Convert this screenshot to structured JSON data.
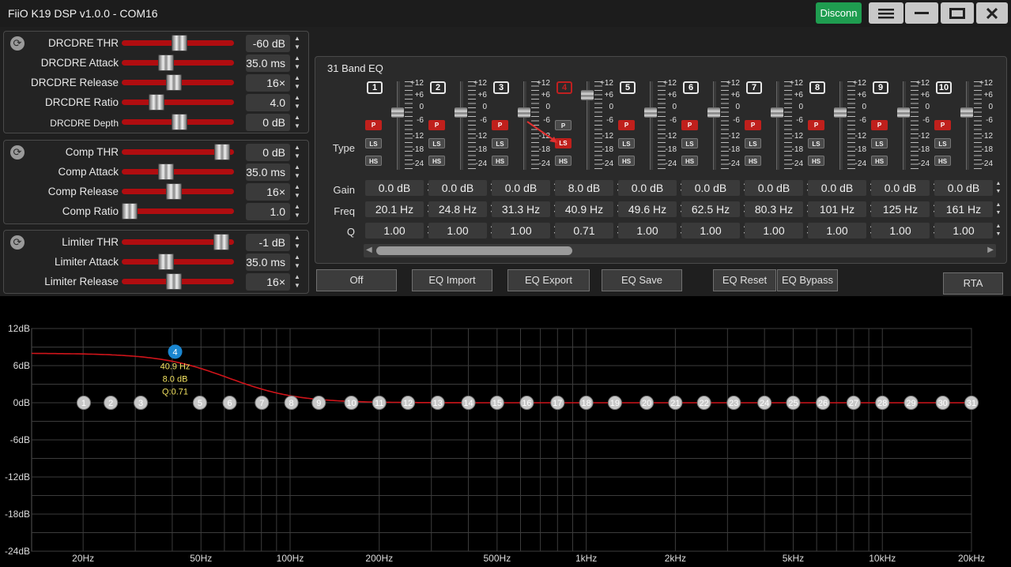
{
  "window": {
    "title": "FiiO K19 DSP v1.0.0 - COM16",
    "disconnect_label": "Disconn"
  },
  "drc": [
    {
      "label": "DRCDRE THR",
      "value": "-60 dB",
      "level": 0.52
    },
    {
      "label": "DRCDRE Attack",
      "value": "35.0 ms",
      "level": 0.38
    },
    {
      "label": "DRCDRE Release",
      "value": "16×",
      "level": 0.46
    },
    {
      "label": "DRCDRE Ratio",
      "value": "4.0",
      "level": 0.28
    },
    {
      "label": "DRCDRE Depth",
      "value": "0 dB",
      "level": 0.52
    }
  ],
  "comp": [
    {
      "label": "Comp THR",
      "value": "0 dB",
      "level": 0.96
    },
    {
      "label": "Comp Attack",
      "value": "35.0 ms",
      "level": 0.38
    },
    {
      "label": "Comp Release",
      "value": "16×",
      "level": 0.46
    },
    {
      "label": "Comp Ratio",
      "value": "1.0",
      "level": 0.0
    }
  ],
  "limiter": [
    {
      "label": "Limiter THR",
      "value": "-1 dB",
      "level": 0.95
    },
    {
      "label": "Limiter Attack",
      "value": "35.0 ms",
      "level": 0.38
    },
    {
      "label": "Limiter Release",
      "value": "16×",
      "level": 0.46
    }
  ],
  "eq": {
    "title": "31 Band EQ",
    "row_labels": {
      "type": "Type",
      "gain": "Gain",
      "freq": "Freq",
      "q": "Q"
    },
    "scale": [
      "+12",
      "+6",
      "0",
      "-6",
      "-12",
      "-18",
      "-24"
    ],
    "type_labels": {
      "p": "P",
      "ls": "LS",
      "hs": "HS"
    },
    "selected": "4",
    "bands": [
      {
        "num": "1",
        "gain": "0.0 dB",
        "freq": "20.1 Hz",
        "q": "1.00",
        "type": "P",
        "level": 0.0
      },
      {
        "num": "2",
        "gain": "0.0 dB",
        "freq": "24.8 Hz",
        "q": "1.00",
        "type": "P",
        "level": 0.0
      },
      {
        "num": "3",
        "gain": "0.0 dB",
        "freq": "31.3 Hz",
        "q": "1.00",
        "type": "P",
        "level": 0.0
      },
      {
        "num": "4",
        "gain": "8.0 dB",
        "freq": "40.9 Hz",
        "q": "0.71",
        "type": "LS",
        "level": 8.0
      },
      {
        "num": "5",
        "gain": "0.0 dB",
        "freq": "49.6 Hz",
        "q": "1.00",
        "type": "P",
        "level": 0.0
      },
      {
        "num": "6",
        "gain": "0.0 dB",
        "freq": "62.5 Hz",
        "q": "1.00",
        "type": "P",
        "level": 0.0
      },
      {
        "num": "7",
        "gain": "0.0 dB",
        "freq": "80.3 Hz",
        "q": "1.00",
        "type": "P",
        "level": 0.0
      },
      {
        "num": "8",
        "gain": "0.0 dB",
        "freq": "101 Hz",
        "q": "1.00",
        "type": "P",
        "level": 0.0
      },
      {
        "num": "9",
        "gain": "0.0 dB",
        "freq": "125 Hz",
        "q": "1.00",
        "type": "P",
        "level": 0.0
      },
      {
        "num": "10",
        "gain": "0.0 dB",
        "freq": "161 Hz",
        "q": "1.00",
        "type": "P",
        "level": 0.0
      }
    ]
  },
  "buttons": {
    "off": "Off",
    "import": "EQ Import",
    "export": "EQ Export",
    "save": "EQ Save",
    "reset": "EQ Reset",
    "bypass": "EQ Bypass",
    "rta": "RTA"
  },
  "graph": {
    "y_labels": [
      "12dB",
      "6dB",
      "0dB",
      "-6dB",
      "-12dB",
      "-18dB",
      "-24dB"
    ],
    "x_labels": [
      {
        "label": "20Hz",
        "f": 20
      },
      {
        "label": "50Hz",
        "f": 50
      },
      {
        "label": "100Hz",
        "f": 100
      },
      {
        "label": "200Hz",
        "f": 200
      },
      {
        "label": "500Hz",
        "f": 500
      },
      {
        "label": "1kHz",
        "f": 1000
      },
      {
        "label": "2kHz",
        "f": 2000
      },
      {
        "label": "5kHz",
        "f": 5000
      },
      {
        "label": "10kHz",
        "f": 10000
      },
      {
        "label": "20kHz",
        "f": 20000
      }
    ],
    "selected_band": {
      "num": "4",
      "freq": "40.9 Hz",
      "gain": "8.0 dB",
      "q": "Q:0.71",
      "f": 40.9,
      "db": 8.0
    },
    "band_freqs": [
      20.1,
      24.8,
      31.3,
      40.9,
      49.6,
      62.5,
      80.3,
      101,
      125,
      161,
      200,
      250,
      315,
      400,
      500,
      630,
      800,
      1000,
      1250,
      1600,
      2000,
      2500,
      3150,
      4000,
      5000,
      6300,
      8000,
      10000,
      12500,
      16000,
      20000
    ],
    "colors": {
      "curve": "#d0141a",
      "marker": "#c8c8c8",
      "selected": "#1a86d0",
      "info": "#f0e060",
      "grid": "#3c3c3c"
    }
  }
}
